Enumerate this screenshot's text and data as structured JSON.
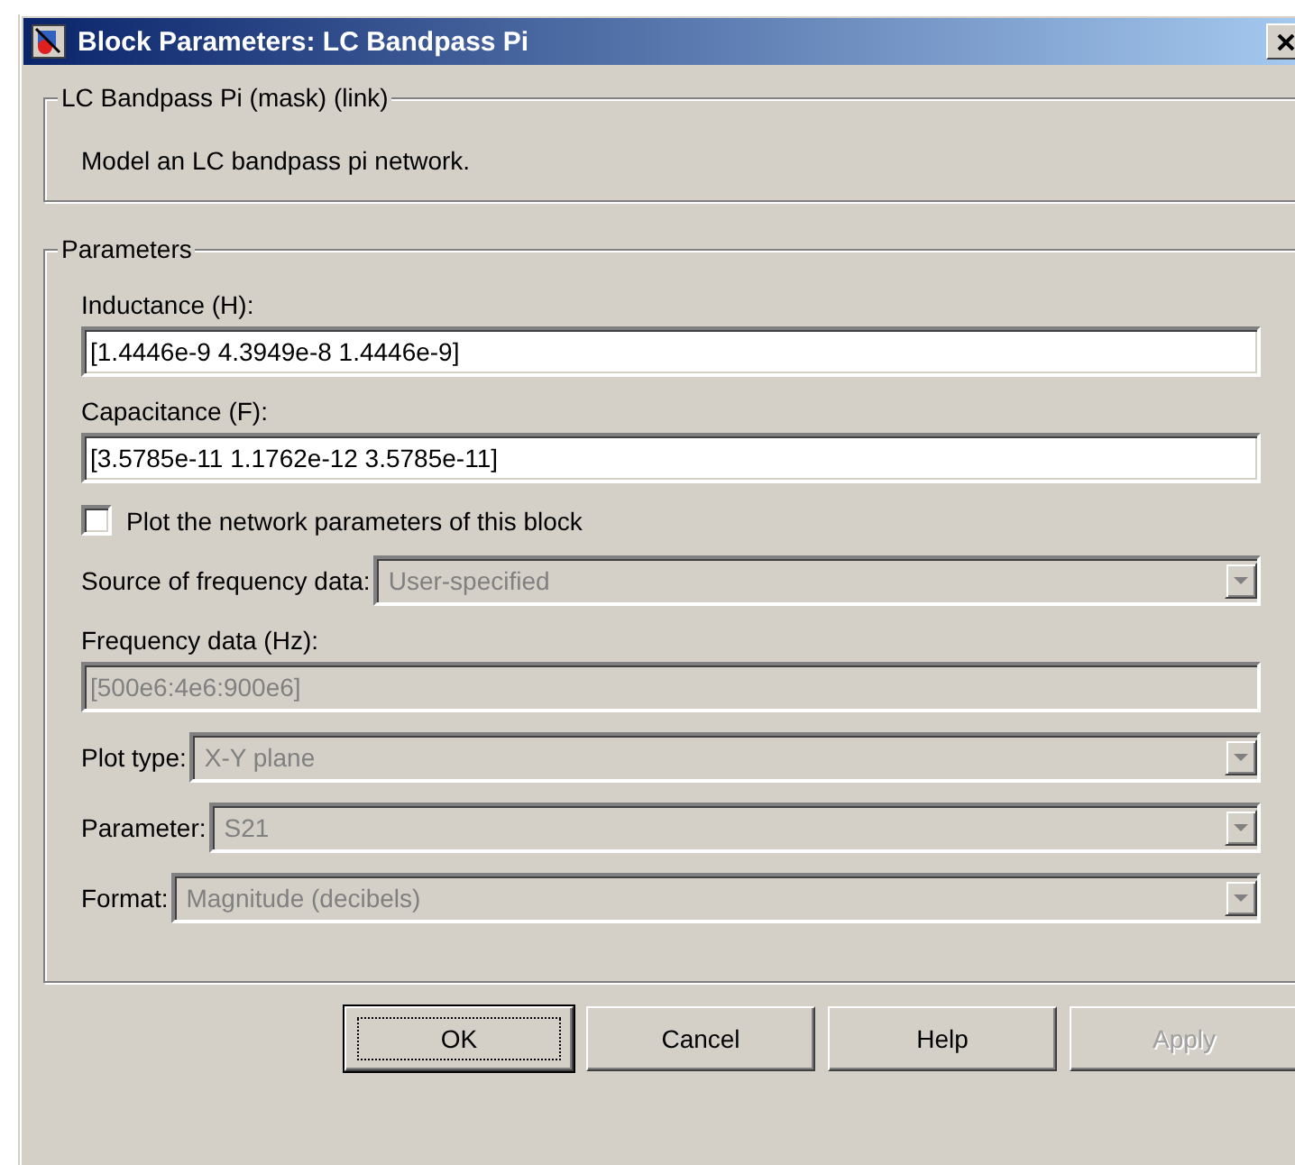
{
  "window": {
    "title": "Block Parameters: LC Bandpass Pi"
  },
  "description_group": {
    "legend": "LC Bandpass Pi (mask) (link)",
    "text": "Model an LC bandpass pi network."
  },
  "parameters": {
    "legend": "Parameters",
    "fields": [
      {
        "kind": "text",
        "label": "Inductance (H):",
        "value": "[1.4446e-9  4.3949e-8  1.4446e-9]",
        "disabled": false
      },
      {
        "kind": "text",
        "label": "Capacitance (F):",
        "value": "[3.5785e-11  1.1762e-12  3.5785e-11]",
        "disabled": false
      },
      {
        "kind": "checkbox",
        "label": "Plot the network parameters of this block",
        "checked": false
      },
      {
        "kind": "dropdown",
        "label": "Source of frequency data:",
        "value": "User-specified",
        "disabled": true
      },
      {
        "kind": "text",
        "label": "Frequency data (Hz):",
        "value": "[500e6:4e6:900e6]",
        "disabled": true
      },
      {
        "kind": "dropdown",
        "label": "Plot type:",
        "value": "X-Y plane",
        "disabled": true
      },
      {
        "kind": "dropdown",
        "label": "Parameter:",
        "value": "S21",
        "disabled": true
      },
      {
        "kind": "dropdown",
        "label": "Format:",
        "value": "Magnitude (decibels)",
        "disabled": true
      }
    ]
  },
  "buttons": [
    {
      "label": "OK",
      "focused": true,
      "disabled": false
    },
    {
      "label": "Cancel",
      "focused": false,
      "disabled": false
    },
    {
      "label": "Help",
      "focused": false,
      "disabled": false
    },
    {
      "label": "Apply",
      "focused": false,
      "disabled": true
    }
  ]
}
